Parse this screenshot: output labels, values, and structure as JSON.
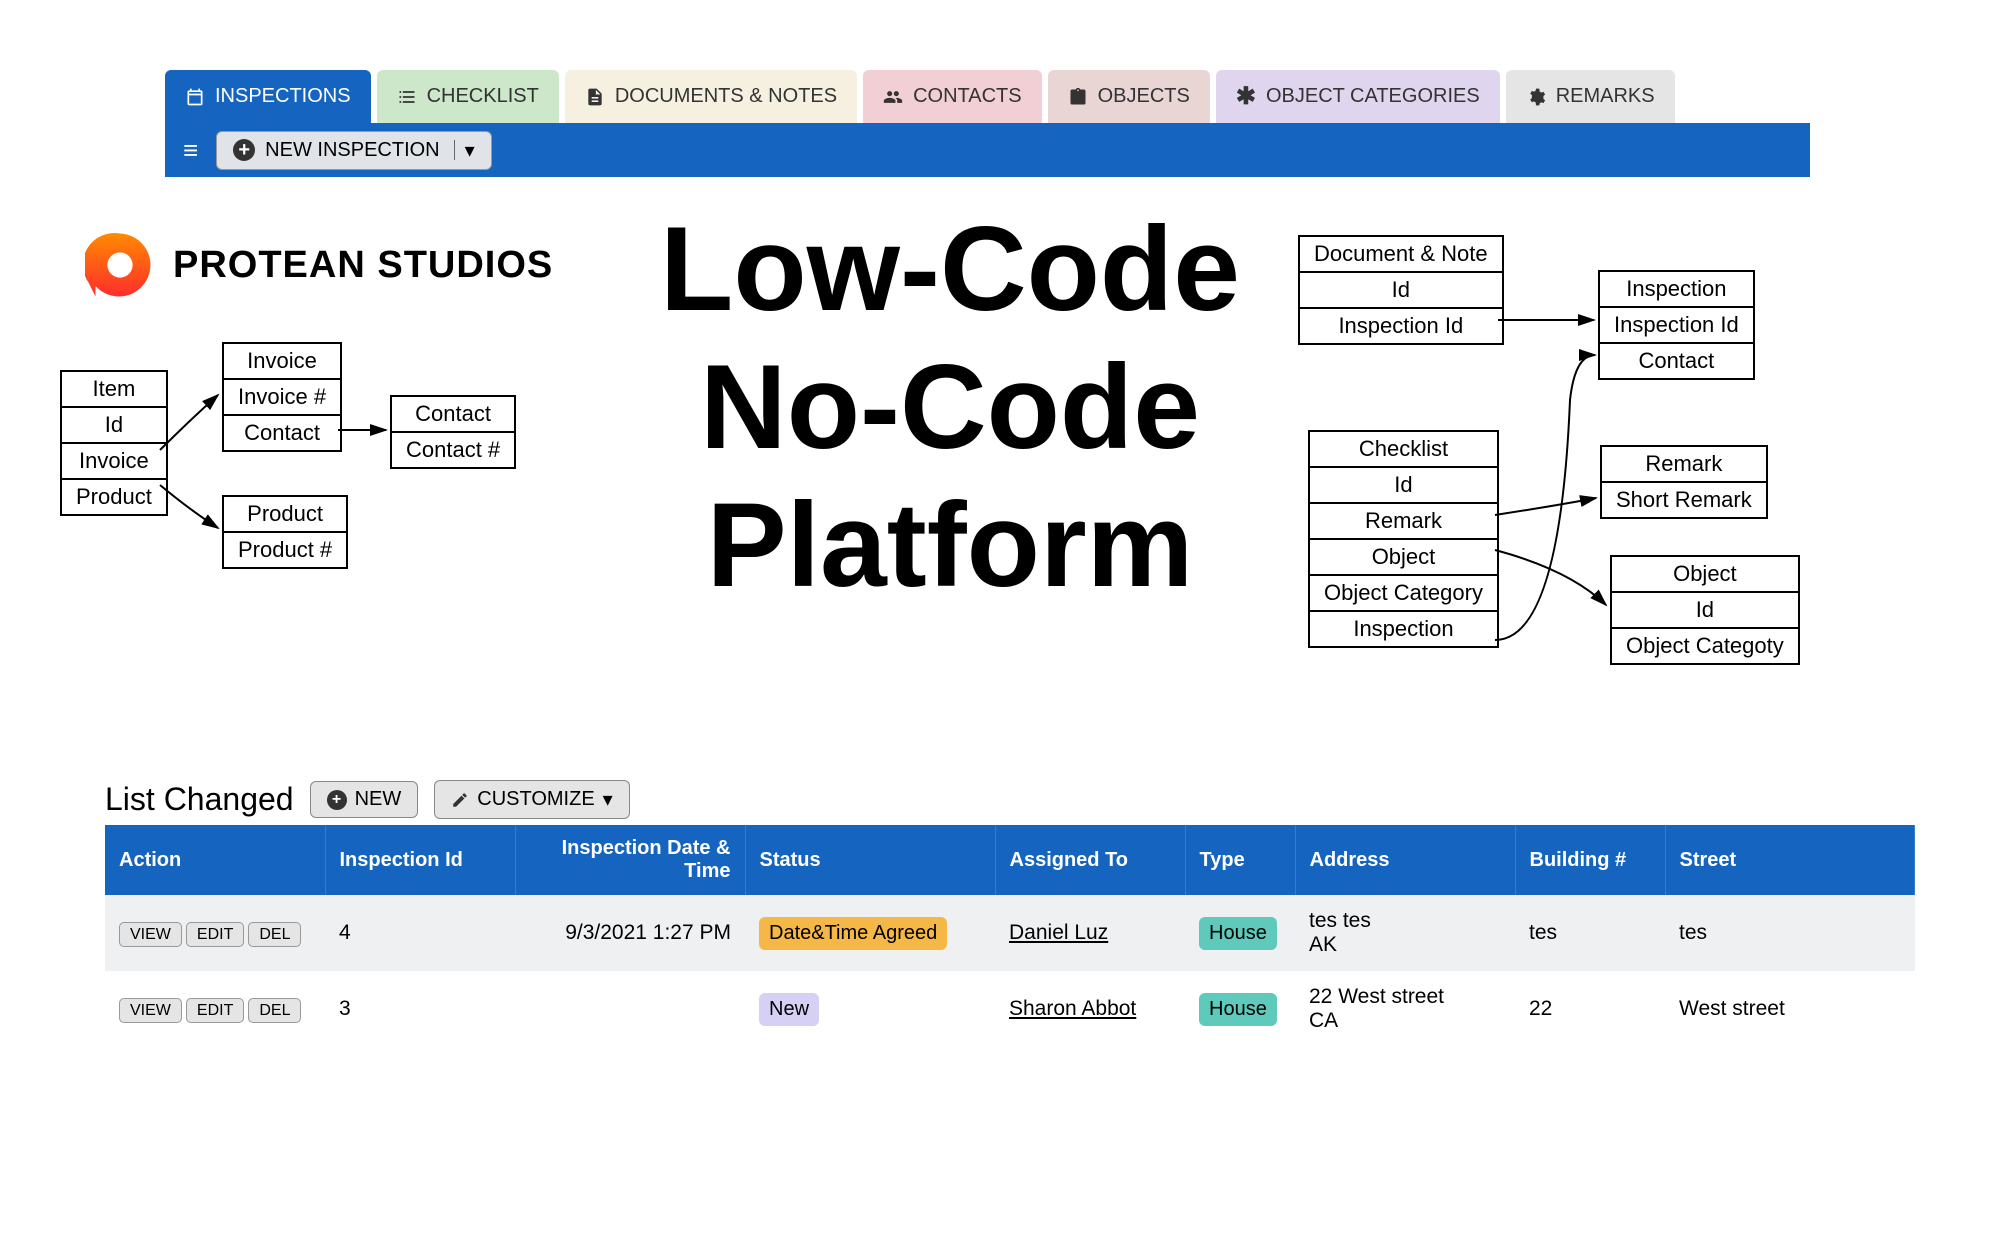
{
  "tabs": [
    {
      "label": "INSPECTIONS"
    },
    {
      "label": "CHECKLIST"
    },
    {
      "label": "DOCUMENTS & NOTES"
    },
    {
      "label": "CONTACTS"
    },
    {
      "label": "OBJECTS"
    },
    {
      "label": "OBJECT CATEGORIES"
    },
    {
      "label": "REMARKS"
    }
  ],
  "toolbar": {
    "new_inspection_label": "NEW INSPECTION"
  },
  "logo_text": "PROTEAN STUDIOS",
  "headline": "Low-Code No-Code Platform",
  "entities_left": {
    "item": [
      "Item",
      "Id",
      "Invoice",
      "Product"
    ],
    "invoice": [
      "Invoice",
      "Invoice #",
      "Contact"
    ],
    "contact": [
      "Contact",
      "Contact #"
    ],
    "product": [
      "Product",
      "Product #"
    ]
  },
  "entities_right": {
    "docnote": [
      "Document & Note",
      "Id",
      "Inspection Id"
    ],
    "inspection": [
      "Inspection",
      "Inspection Id",
      "Contact"
    ],
    "checklist": [
      "Checklist",
      "Id",
      "Remark",
      "Object",
      "Object Category",
      "Inspection"
    ],
    "remark": [
      "Remark",
      "Short Remark"
    ],
    "object": [
      "Object",
      "Id",
      "Object Categoty"
    ]
  },
  "list": {
    "title": "List Changed",
    "new_label": "NEW",
    "customize_label": "CUSTOMIZE",
    "columns": [
      "Action",
      "Inspection Id",
      "Inspection Date & Time",
      "Status",
      "Assigned To",
      "Type",
      "Address",
      "Building #",
      "Street"
    ],
    "row_actions": [
      "VIEW",
      "EDIT",
      "DEL"
    ],
    "rows": [
      {
        "id": "4",
        "date": "9/3/2021 1:27 PM",
        "status": "Date&Time Agreed",
        "status_color": "orange",
        "assigned": "Daniel Luz",
        "type": "House",
        "addr1": "tes tes",
        "addr2": "AK",
        "building": "tes",
        "street": "tes"
      },
      {
        "id": "3",
        "date": "",
        "status": "New",
        "status_color": "purple",
        "assigned": "Sharon Abbot",
        "type": "House",
        "addr1": "22 West street",
        "addr2": "CA",
        "building": "22",
        "street": "West street"
      }
    ]
  }
}
